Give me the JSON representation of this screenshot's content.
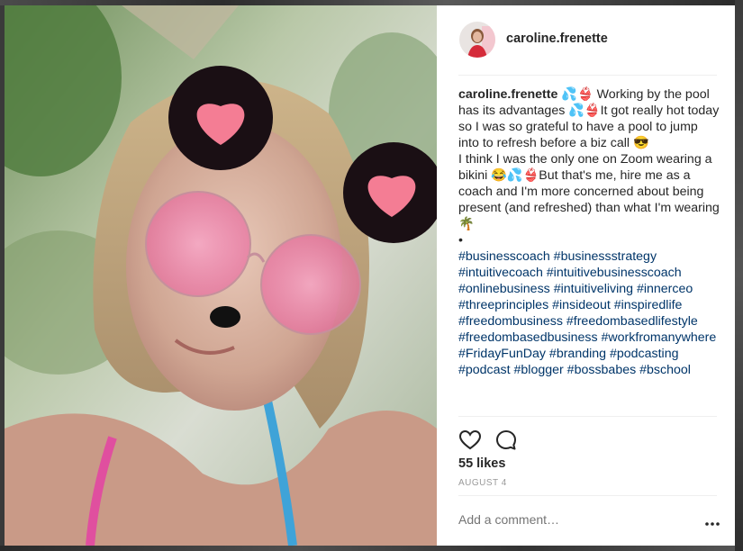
{
  "post": {
    "username": "caroline.frenette",
    "caption_lines": [
      "💦👙 Working by the pool has its advantages 💦👙It got really hot today so I was so grateful to have a pool to jump into to refresh before a biz call 😎",
      "I think I was the only one on Zoom wearing a bikini 😂💦👙But that's me, hire me as a coach and I'm more concerned about being present (and refreshed) than what I'm wearing 🌴",
      "•"
    ],
    "hashtags": "#businesscoach #businessstrategy #intuitivecoach #intuitivebusinesscoach #onlinebusiness #intuitiveliving #innerceo #threeprinciples #insideout #inspiredlife #freedombusiness #freedombasedlifestyle #freedombasedbusiness #workfromanywhere #FridayFunDay #branding #podcasting #podcast #blogger #bossbabes #bschool",
    "likes": "55 likes",
    "date": "AUGUST 4",
    "comment_placeholder": "Add a comment…"
  },
  "icons": {
    "like": "heart-icon",
    "comment": "speech-bubble-icon",
    "more": "ellipsis-icon"
  },
  "colors": {
    "text": "#262626",
    "hashtag": "#003569",
    "muted": "#999999",
    "divider": "#efefef"
  }
}
